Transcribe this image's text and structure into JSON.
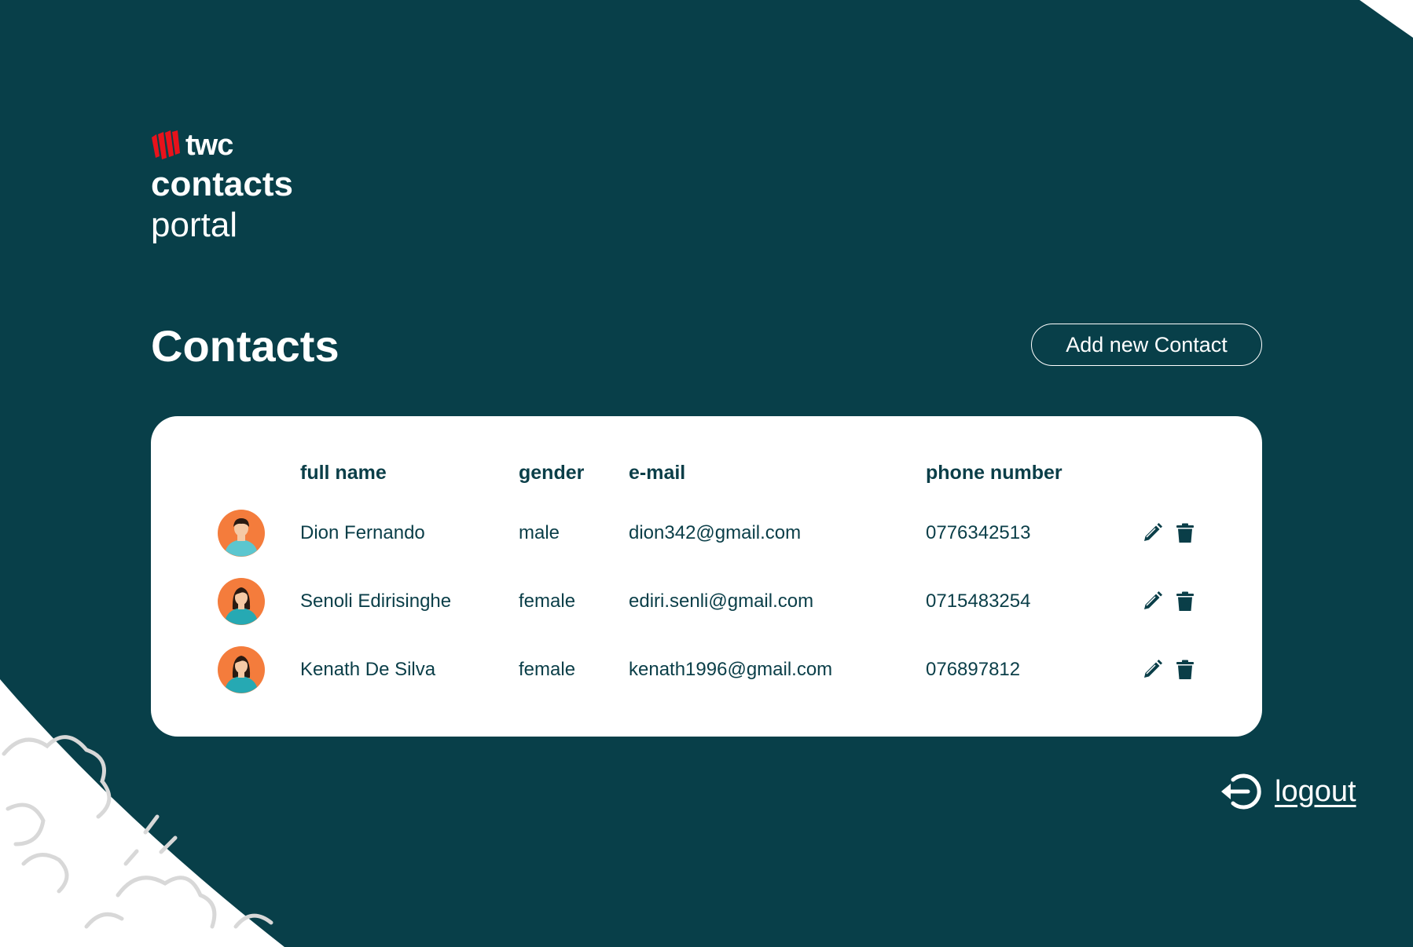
{
  "colors": {
    "primary": "#083f49",
    "white": "#ffffff",
    "avatar": "#f47c3c",
    "brand_red": "#e8121b"
  },
  "brand": {
    "logo_icon": "twc-stripes-logo",
    "name": "twc",
    "line1": "contacts",
    "line2": "portal"
  },
  "page": {
    "title": "Contacts",
    "add_button": "Add new Contact"
  },
  "table": {
    "headers": {
      "full_name": "full name",
      "gender": "gender",
      "email": "e-mail",
      "phone": "phone number"
    },
    "rows": [
      {
        "avatar": "male-avatar-icon",
        "full_name": "Dion Fernando",
        "gender": "male",
        "email": "dion342@gmail.com",
        "phone": "0776342513"
      },
      {
        "avatar": "female-avatar-icon",
        "full_name": "Senoli Edirisinghe",
        "gender": "female",
        "email": "ediri.senli@gmail.com",
        "phone": "0715483254"
      },
      {
        "avatar": "female-avatar-icon",
        "full_name": "Kenath De Silva",
        "gender": "female",
        "email": "kenath1996@gmail.com",
        "phone": "076897812"
      }
    ],
    "actions": {
      "edit_icon": "pencil-icon",
      "delete_icon": "trash-icon"
    }
  },
  "logout": {
    "icon": "logout-arrow-icon",
    "label": "logout"
  }
}
